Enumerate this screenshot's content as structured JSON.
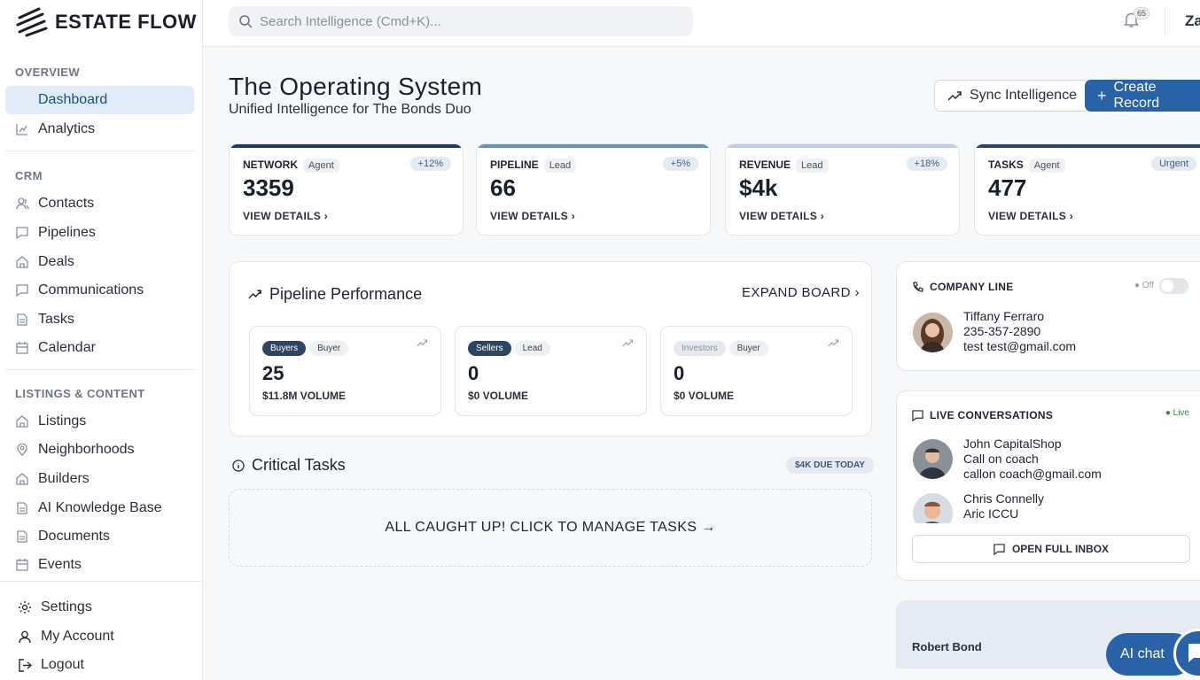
{
  "app": {
    "name": "ESTATE FLOW"
  },
  "sidebar": {
    "overview": {
      "heading": "OVERVIEW",
      "items": [
        {
          "label": "Dashboard",
          "icon": "none",
          "active": true
        },
        {
          "label": "Analytics",
          "icon": "chart-icon"
        }
      ]
    },
    "crm": {
      "heading": "CRM",
      "items": [
        {
          "label": "Contacts",
          "icon": "users-icon"
        },
        {
          "label": "Pipelines",
          "icon": "message-icon"
        },
        {
          "label": "Deals",
          "icon": "building-icon"
        },
        {
          "label": "Communications",
          "icon": "message-icon"
        },
        {
          "label": "Tasks",
          "icon": "document-icon"
        },
        {
          "label": "Calendar",
          "icon": "calendar-icon"
        }
      ]
    },
    "listings": {
      "heading": "LISTINGS & CONTENT",
      "items": [
        {
          "label": "Listings",
          "icon": "building-icon"
        },
        {
          "label": "Neighborhoods",
          "icon": "pin-icon"
        },
        {
          "label": "Builders",
          "icon": "building-icon"
        },
        {
          "label": "AI Knowledge Base",
          "icon": "document-icon"
        },
        {
          "label": "Documents",
          "icon": "document-icon"
        },
        {
          "label": "Events",
          "icon": "calendar-icon"
        }
      ]
    },
    "footer": [
      {
        "label": "Settings",
        "icon": "gear-icon"
      },
      {
        "label": "My Account",
        "icon": "user-icon"
      },
      {
        "label": "Logout",
        "icon": "logout-icon"
      }
    ]
  },
  "topbar": {
    "search_placeholder": "Search Intelligence (Cmd+K)...",
    "notification_count": "65",
    "user_name": "Za"
  },
  "header": {
    "title": "The Operating System",
    "subtitle": "Unified Intelligence for The Bonds Duo",
    "sync_label": "Sync Intelligence",
    "create_label": "Create Record"
  },
  "stats": [
    {
      "label": "NETWORK",
      "chip": "Agent",
      "delta": "+12%",
      "value": "3359",
      "link": "VIEW DETAILS",
      "bar": "#1e3a5c"
    },
    {
      "label": "PIPELINE",
      "chip": "Lead",
      "delta": "+5%",
      "value": "66",
      "link": "VIEW DETAILS",
      "bar": "#6a8fb8"
    },
    {
      "label": "REVENUE",
      "chip": "Lead",
      "delta": "+18%",
      "value": "$4k",
      "link": "VIEW DETAILS",
      "bar": "#bfcde0"
    },
    {
      "label": "TASKS",
      "chip": "Agent",
      "delta": "Urgent",
      "value": "477",
      "link": "VIEW DETAILS",
      "bar": "#2a4668"
    }
  ],
  "pipeline": {
    "title": "Pipeline Performance",
    "expand": "EXPAND BOARD",
    "cards": [
      {
        "tag": "Buyers",
        "tag2": "Buyer",
        "count": "25",
        "volume": "$11.8M VOLUME",
        "style": "dark"
      },
      {
        "tag": "Sellers",
        "tag2": "Lead",
        "count": "0",
        "volume": "$0 VOLUME",
        "style": "dark"
      },
      {
        "tag": "Investors",
        "tag2": "Buyer",
        "count": "0",
        "volume": "$0 VOLUME",
        "style": "grey"
      }
    ]
  },
  "critical": {
    "title": "Critical Tasks",
    "due": "$4K DUE TODAY",
    "empty": "ALL CAUGHT UP! CLICK TO MANAGE TASKS →"
  },
  "company_line": {
    "title": "COMPANY LINE",
    "status": "● Off",
    "contact": {
      "name": "Tiffany Ferraro",
      "phone": "235-357-2890",
      "email": "test test@gmail.com"
    }
  },
  "live": {
    "title": "LIVE CONVERSATIONS",
    "status": "● Live",
    "conversations": [
      {
        "name": "John CapitalShop",
        "line1": "Call on coach",
        "line2": "callon coach@gmail.com"
      },
      {
        "name": "Chris Connelly",
        "line1": "Aric ICCU"
      }
    ],
    "inbox": "OPEN FULL INBOX"
  },
  "agent_card": {
    "name": "Robert Bond"
  },
  "ai_chat": {
    "label": "AI chat"
  },
  "colors": {
    "primary": "#2a62a8",
    "active_bg": "#e2ecf8"
  }
}
